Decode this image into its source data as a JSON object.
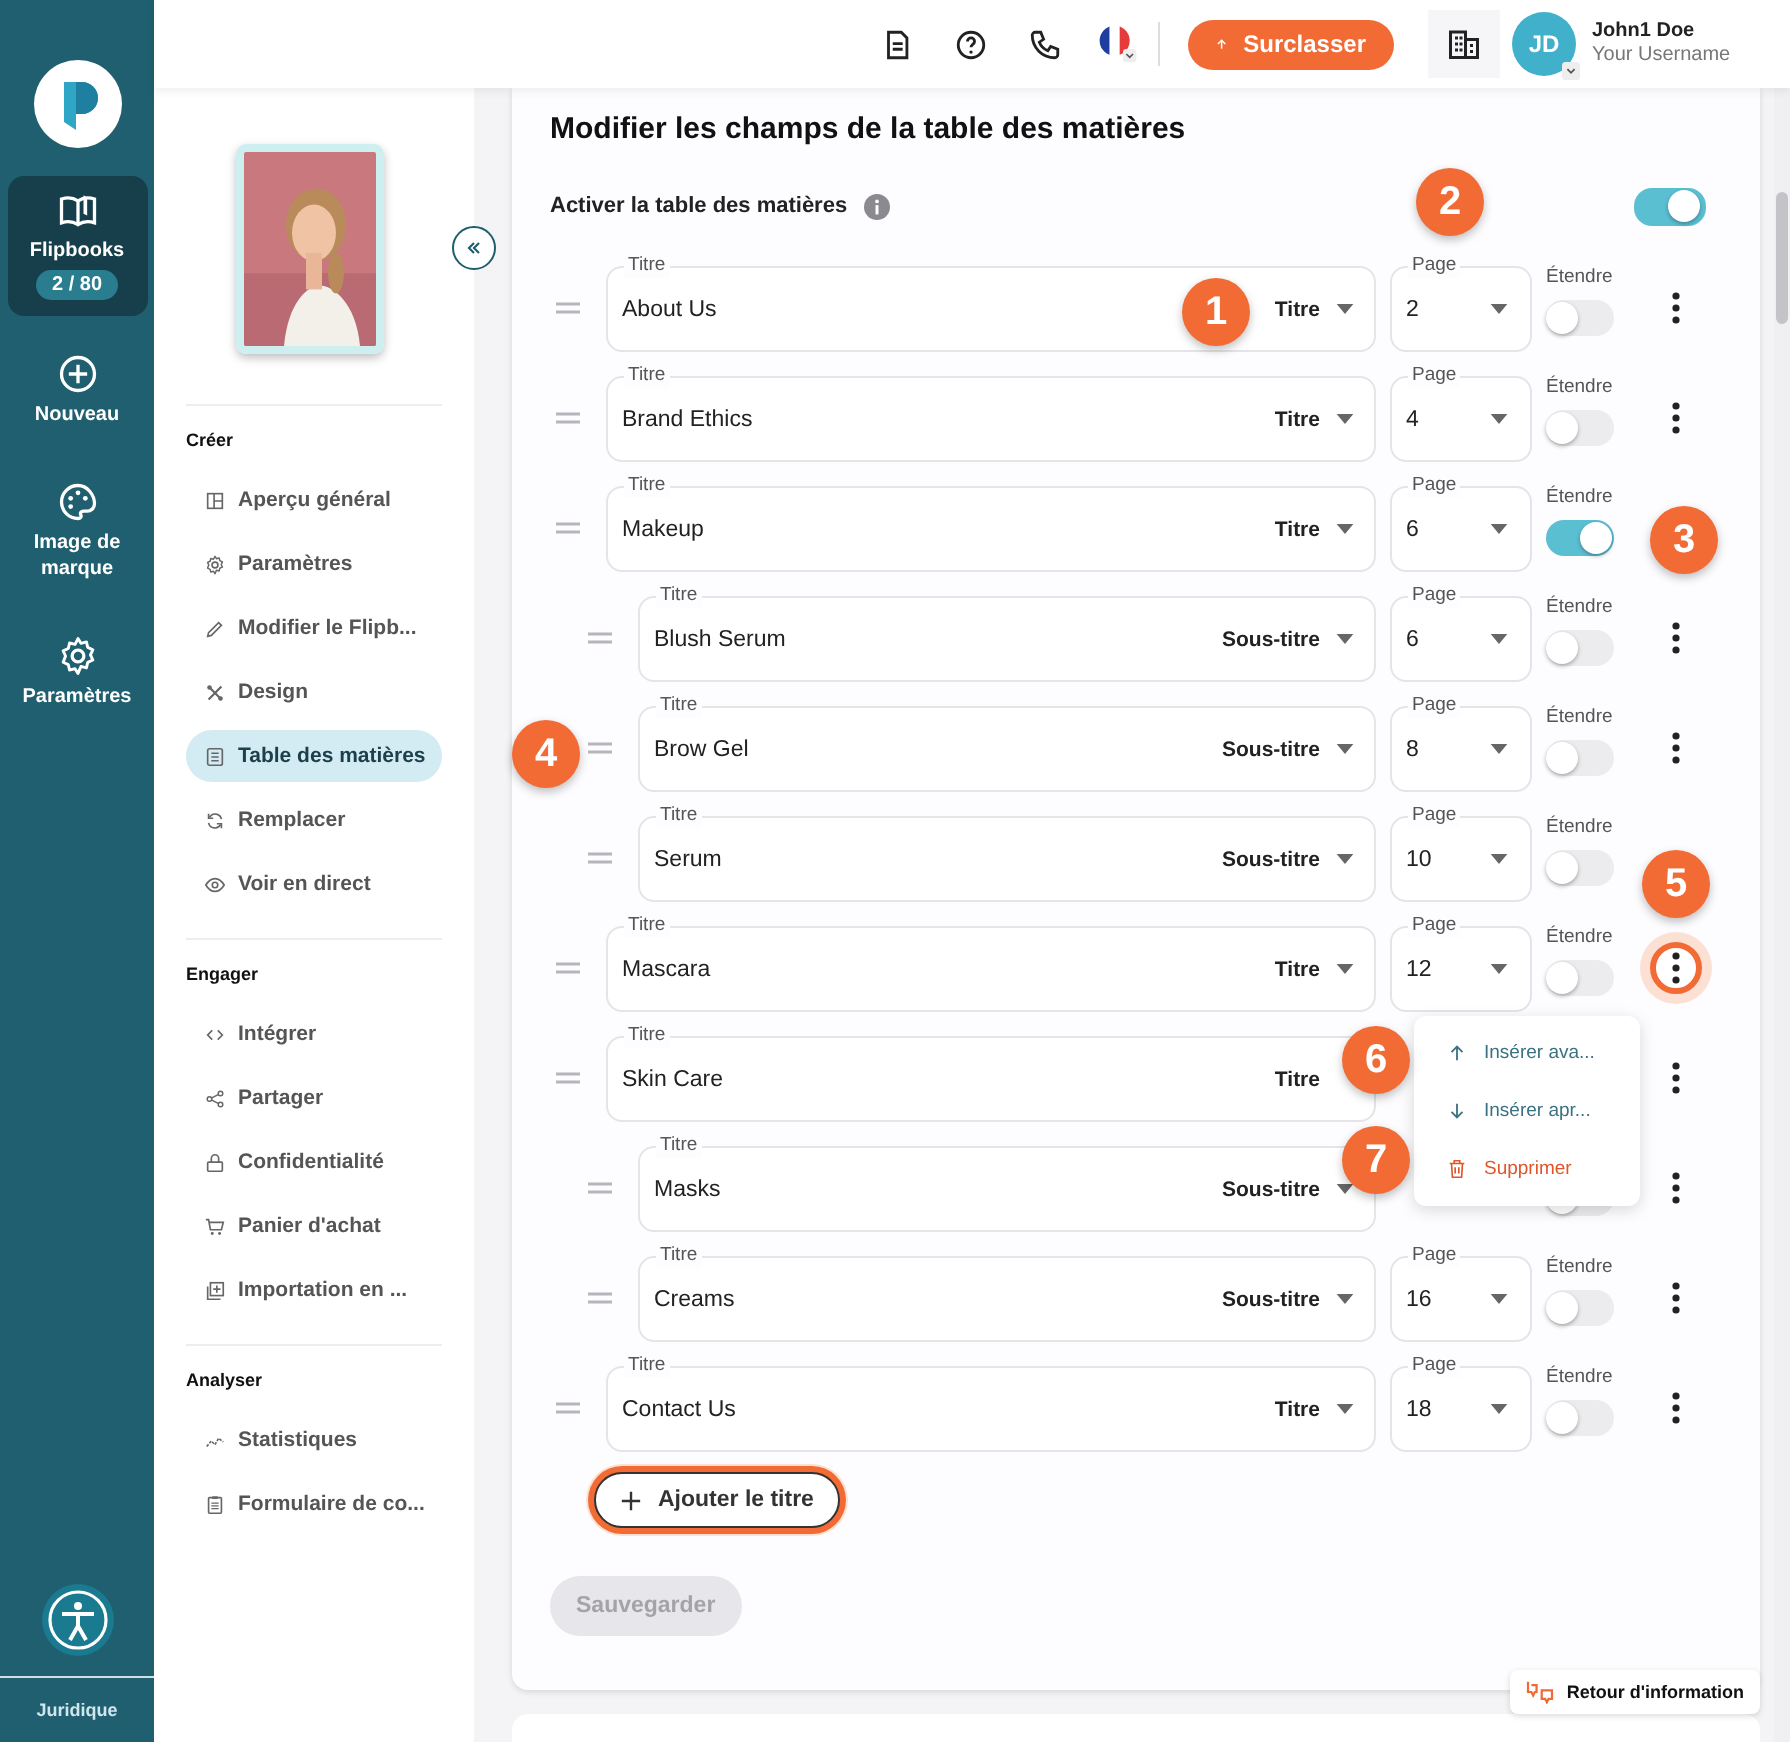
{
  "rail": {
    "items": [
      {
        "label": "Flipbooks",
        "badge": "2 / 80",
        "selected": true
      },
      {
        "label": "Nouveau",
        "selected": false
      },
      {
        "label": "Image de marque",
        "selected": false
      },
      {
        "label": "Paramètres",
        "selected": false
      }
    ],
    "footer": "Juridique"
  },
  "header": {
    "upgrade": "Surclasser",
    "user": {
      "initials": "JD",
      "name": "John1 Doe",
      "username": "Your Username"
    }
  },
  "sidebar": {
    "sections": [
      {
        "title": "Créer",
        "items": [
          {
            "label": "Aperçu général",
            "selected": false
          },
          {
            "label": "Paramètres",
            "selected": false
          },
          {
            "label": "Modifier le Flipb...",
            "selected": false
          },
          {
            "label": "Design",
            "selected": false
          },
          {
            "label": "Table des matières",
            "selected": true
          },
          {
            "label": "Remplacer",
            "selected": false
          },
          {
            "label": "Voir en direct",
            "selected": false
          }
        ]
      },
      {
        "title": "Engager",
        "items": [
          {
            "label": "Intégrer",
            "selected": false
          },
          {
            "label": "Partager",
            "selected": false
          },
          {
            "label": "Confidentialité",
            "selected": false
          },
          {
            "label": "Panier d'achat",
            "selected": false
          },
          {
            "label": "Importation en ...",
            "selected": false
          }
        ]
      },
      {
        "title": "Analyser",
        "items": [
          {
            "label": "Statistiques",
            "selected": false
          },
          {
            "label": "Formulaire de co...",
            "selected": false
          }
        ]
      }
    ]
  },
  "main": {
    "title": "Modifier les champs de la table des matières",
    "enable": {
      "label": "Activer la table des matières",
      "on": true
    },
    "rows": [
      {
        "kind": "titre",
        "field_label": "Titre",
        "value": "About Us",
        "type": "Titre",
        "page_label": "Page",
        "page": "2",
        "expand_label": "Étendre",
        "expand": false,
        "menu_open": false
      },
      {
        "kind": "titre",
        "field_label": "Titre",
        "value": "Brand Ethics",
        "type": "Titre",
        "page_label": "Page",
        "page": "4",
        "expand_label": "Étendre",
        "expand": false,
        "menu_open": false
      },
      {
        "kind": "titre",
        "field_label": "Titre",
        "value": "Makeup",
        "type": "Titre",
        "page_label": "Page",
        "page": "6",
        "expand_label": "Étendre",
        "expand": true,
        "menu_button": false
      },
      {
        "kind": "sous-titre",
        "field_label": "Titre",
        "value": "Blush Serum",
        "type": "Sous-titre",
        "page_label": "Page",
        "page": "6",
        "expand_label": "Étendre",
        "expand": false,
        "menu_open": false
      },
      {
        "kind": "sous-titre",
        "field_label": "Titre",
        "value": "Brow Gel",
        "type": "Sous-titre",
        "page_label": "Page",
        "page": "8",
        "expand_label": "Étendre",
        "expand": false,
        "menu_open": false
      },
      {
        "kind": "sous-titre",
        "field_label": "Titre",
        "value": "Serum",
        "type": "Sous-titre",
        "page_label": "Page",
        "page": "10",
        "expand_label": "Étendre",
        "expand": false,
        "menu_button": false
      },
      {
        "kind": "titre",
        "field_label": "Titre",
        "value": "Mascara",
        "type": "Titre",
        "page_label": "Page",
        "page": "12",
        "expand_label": "Étendre",
        "expand": false,
        "menu_open": true
      },
      {
        "kind": "titre",
        "field_label": "Titre",
        "value": "Skin Care",
        "type": "Titre",
        "type_caret": false,
        "menu_open": false
      },
      {
        "kind": "sous-titre",
        "field_label": "Titre",
        "value": "Masks",
        "type": "Sous-titre",
        "expand": false,
        "menu_open": false
      },
      {
        "kind": "sous-titre",
        "field_label": "Titre",
        "value": "Creams",
        "type": "Sous-titre",
        "page_label": "Page",
        "page": "16",
        "expand_label": "Étendre",
        "expand": false,
        "menu_open": false
      },
      {
        "kind": "titre",
        "field_label": "Titre",
        "value": "Contact Us",
        "type": "Titre",
        "page_label": "Page",
        "page": "18",
        "expand_label": "Étendre",
        "expand": false,
        "menu_open": false
      }
    ],
    "menu": [
      {
        "kind": "up",
        "label": "Insérer ava..."
      },
      {
        "kind": "down",
        "label": "Insérer apr..."
      },
      {
        "kind": "delete",
        "label": "Supprimer"
      }
    ],
    "add_button": {
      "label": "Ajouter le titre",
      "highlighted": true
    },
    "save_button": {
      "label": "Sauvegarder",
      "disabled": true
    }
  },
  "feedback": "Retour d'information",
  "callouts": [
    {
      "label": "1"
    },
    {
      "label": "2"
    },
    {
      "label": "3"
    },
    {
      "label": "4"
    },
    {
      "label": "5"
    },
    {
      "label": "6"
    },
    {
      "label": "7"
    }
  ]
}
